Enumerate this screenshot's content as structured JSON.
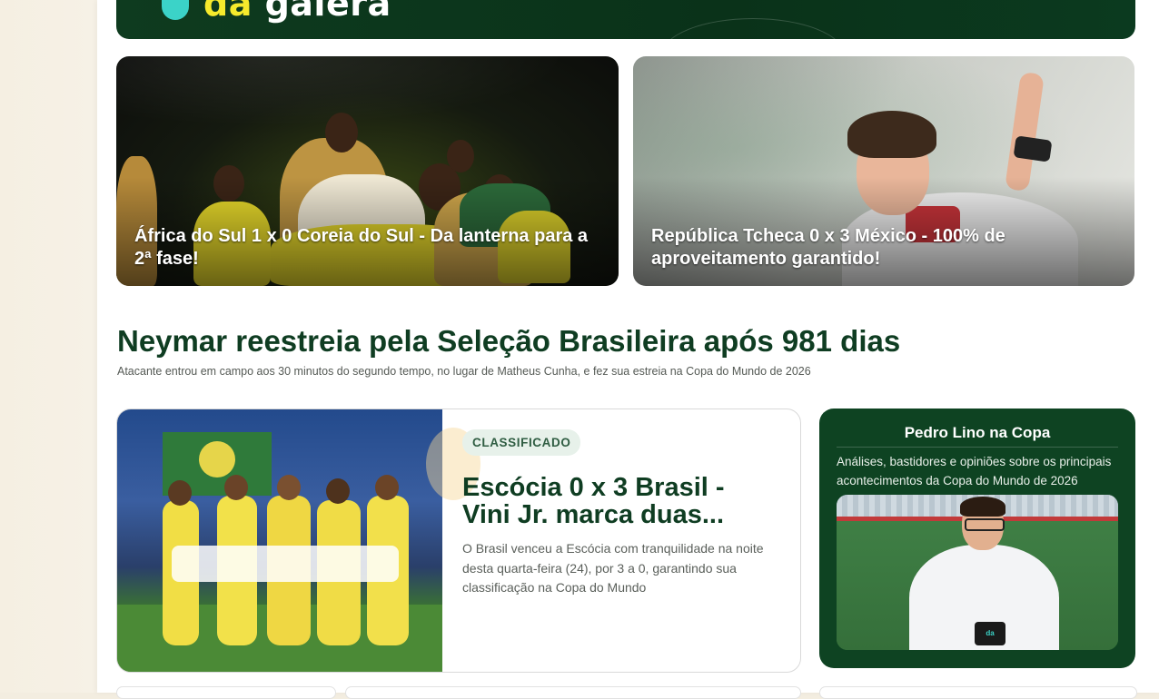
{
  "banner": {
    "logo_text_prefix": "",
    "logo_text_highlight": "da",
    "logo_text_rest": "galera"
  },
  "featured": [
    {
      "title": "África do Sul 1 x 0 Coreia do Sul - Da lanterna para a 2ª fase!"
    },
    {
      "title": "República Tcheca 0 x 3 México - 100% de aproveitamento garantido!"
    }
  ],
  "section": {
    "title": "Neymar reestreia pela Seleção Brasileira após 981 dias",
    "subtitle": "Atacante entrou em campo aos 30 minutos do segundo tempo, no lugar de Matheus Cunha, e fez sua estreia na Copa do Mundo de 2026"
  },
  "article": {
    "badge": "CLASSIFICADO",
    "headline": "Escócia 0 x 3 Brasil - Vini Jr. marca duas...",
    "lede": "O Brasil venceu a Escócia com tranquilidade na noite desta quarta-feira (24), por 3 a 0, garantindo sua classificação na Copa do Mundo"
  },
  "side": {
    "title": "Pedro Lino na Copa",
    "description": "Análises, bastidores e opiniões sobre os principais acontecimentos da Copa do Mundo de 2026",
    "shirt_logo": "da galera"
  },
  "colors": {
    "brand_green": "#0f3d22",
    "side_card_bg": "#0e4322",
    "badge_bg": "#e7f1ea",
    "logo_yellow": "#f6ea2c",
    "logo_teal": "#3bd3c8"
  }
}
